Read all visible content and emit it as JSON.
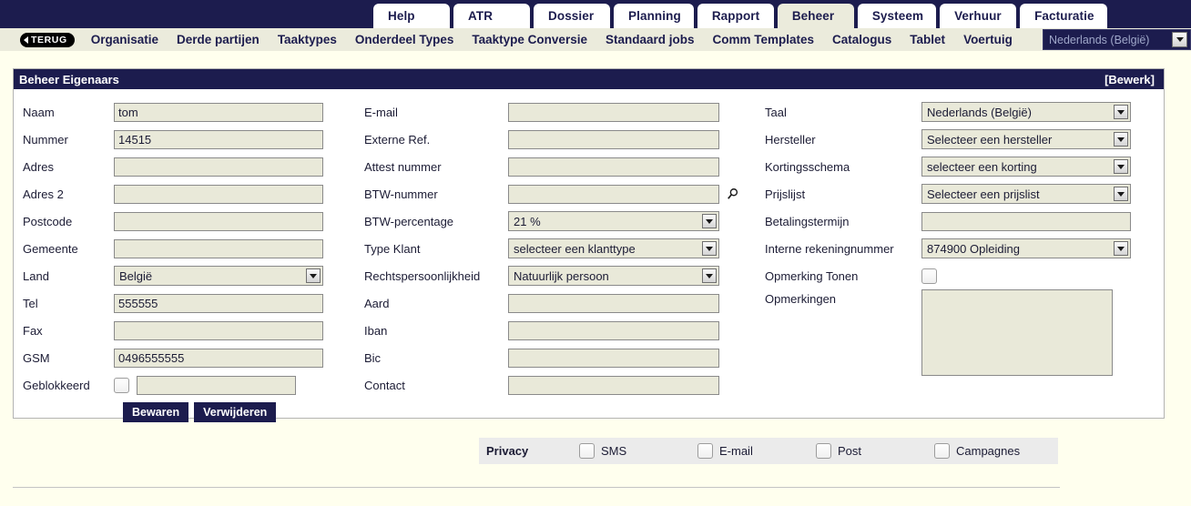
{
  "nav": {
    "tabs": [
      {
        "label": "Help",
        "active": false
      },
      {
        "label": "ATR",
        "active": false
      },
      {
        "label": "Dossier",
        "active": false
      },
      {
        "label": "Planning",
        "active": false
      },
      {
        "label": "Rapport",
        "active": false
      },
      {
        "label": "Beheer",
        "active": true
      },
      {
        "label": "Systeem",
        "active": false
      },
      {
        "label": "Verhuur",
        "active": false
      },
      {
        "label": "Facturatie",
        "active": false
      }
    ],
    "back_label": "TERUG",
    "submenu": [
      "Organisatie",
      "Derde partijen",
      "Taaktypes",
      "Onderdeel Types",
      "Taaktype Conversie",
      "Standaard jobs",
      "Comm Templates",
      "Catalogus",
      "Tablet",
      "Voertuig"
    ],
    "language": "Nederlands (België)"
  },
  "panel": {
    "title": "Beheer Eigenaars",
    "edit_label": "[Bewerk]"
  },
  "column_left": {
    "naam": {
      "label": "Naam",
      "value": "tom"
    },
    "nummer": {
      "label": "Nummer",
      "value": "14515"
    },
    "adres": {
      "label": "Adres",
      "value": ""
    },
    "adres2": {
      "label": "Adres 2",
      "value": ""
    },
    "postcode": {
      "label": "Postcode",
      "value": ""
    },
    "gemeente": {
      "label": "Gemeente",
      "value": ""
    },
    "land": {
      "label": "Land",
      "value": "België"
    },
    "tel": {
      "label": "Tel",
      "value": "555555"
    },
    "fax": {
      "label": "Fax",
      "value": ""
    },
    "gsm": {
      "label": "GSM",
      "value": "0496555555"
    },
    "geblokkeerd": {
      "label": "Geblokkeerd",
      "checked": false,
      "value": ""
    },
    "save_label": "Bewaren",
    "delete_label": "Verwijderen"
  },
  "column_middle": {
    "email": {
      "label": "E-mail",
      "value": ""
    },
    "externe_ref": {
      "label": "Externe Ref.",
      "value": ""
    },
    "attest_nummer": {
      "label": "Attest nummer",
      "value": ""
    },
    "btw_nummer": {
      "label": "BTW-nummer",
      "value": "",
      "icon": "magnifier-icon"
    },
    "btw_percentage": {
      "label": "BTW-percentage",
      "value": "21 %"
    },
    "type_klant": {
      "label": "Type Klant",
      "value": "selecteer een klanttype"
    },
    "rechtspersoonlijkheid": {
      "label": "Rechtspersoonlijkheid",
      "value": "Natuurlijk persoon"
    },
    "aard": {
      "label": "Aard",
      "value": ""
    },
    "iban": {
      "label": "Iban",
      "value": ""
    },
    "bic": {
      "label": "Bic",
      "value": ""
    },
    "contact": {
      "label": "Contact",
      "value": ""
    }
  },
  "column_right": {
    "taal": {
      "label": "Taal",
      "value": "Nederlands (België)"
    },
    "hersteller": {
      "label": "Hersteller",
      "value": "Selecteer een hersteller"
    },
    "kortingsschema": {
      "label": "Kortingsschema",
      "value": "selecteer een korting"
    },
    "prijslijst": {
      "label": "Prijslijst",
      "value": "Selecteer een prijslist"
    },
    "betalingstermijn": {
      "label": "Betalingstermijn",
      "value": ""
    },
    "interne_rekeningnummer": {
      "label": "Interne rekeningnummer",
      "value": "874900 Opleiding"
    },
    "opmerking_tonen": {
      "label": "Opmerking Tonen",
      "checked": false
    },
    "opmerkingen": {
      "label": "Opmerkingen",
      "value": ""
    }
  },
  "privacy": {
    "title": "Privacy",
    "options": [
      {
        "label": "SMS",
        "checked": false
      },
      {
        "label": "E-mail",
        "checked": false
      },
      {
        "label": "Post",
        "checked": false
      },
      {
        "label": "Campagnes",
        "checked": false
      }
    ]
  },
  "colors": {
    "navy": "#1c1c4e",
    "cream": "#ebebdc",
    "field": "#e9e9d9",
    "page_bg": "#ffffee"
  }
}
